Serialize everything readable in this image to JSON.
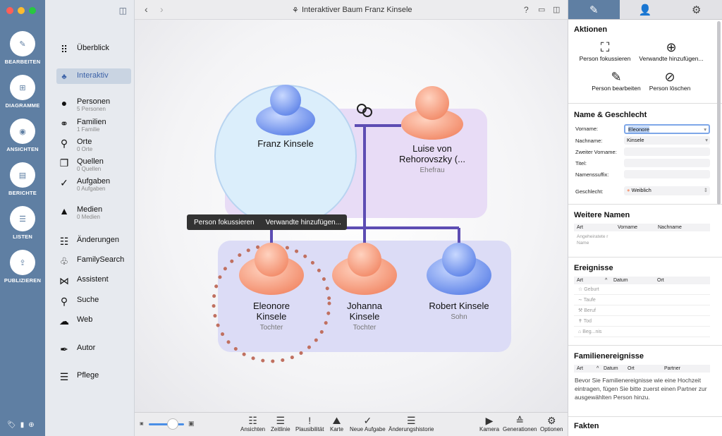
{
  "window_title": "Interaktiver Baum Franz Kinsele",
  "rail": [
    {
      "label": "BEARBEITEN",
      "icon": "pencil"
    },
    {
      "label": "DIAGRAMME",
      "icon": "diagram"
    },
    {
      "label": "ANSICHTEN",
      "icon": "eye"
    },
    {
      "label": "BERICHTE",
      "icon": "report"
    },
    {
      "label": "LISTEN",
      "icon": "list"
    },
    {
      "label": "PUBLIZIEREN",
      "icon": "upload"
    }
  ],
  "nav": [
    {
      "label": "Überblick",
      "sub": ""
    },
    {
      "label": "Interaktiv",
      "sub": ""
    },
    {
      "label": "Personen",
      "sub": "5 Personen"
    },
    {
      "label": "Familien",
      "sub": "1 Familie"
    },
    {
      "label": "Orte",
      "sub": "0 Orte"
    },
    {
      "label": "Quellen",
      "sub": "0 Quellen"
    },
    {
      "label": "Aufgaben",
      "sub": "0 Aufgaben"
    },
    {
      "label": "Medien",
      "sub": "0 Medien"
    },
    {
      "label": "Änderungen",
      "sub": ""
    },
    {
      "label": "FamilySearch",
      "sub": ""
    },
    {
      "label": "Assistent",
      "sub": ""
    },
    {
      "label": "Suche",
      "sub": ""
    },
    {
      "label": "Web",
      "sub": ""
    },
    {
      "label": "Autor",
      "sub": ""
    },
    {
      "label": "Pflege",
      "sub": ""
    }
  ],
  "tree": {
    "father": {
      "name": "Franz Kinsele",
      "role": ""
    },
    "mother": {
      "name": "Luise von Rehorovszky (...",
      "role": "Ehefrau"
    },
    "children": [
      {
        "name": "Eleonore Kinsele",
        "role": "Tochter"
      },
      {
        "name": "Johanna Kinsele",
        "role": "Tochter"
      },
      {
        "name": "Robert  Kinsele",
        "role": "Sohn"
      }
    ],
    "tooltip_focus": "Person fokussieren",
    "tooltip_add": "Verwandte hinzufügen..."
  },
  "bottombar": [
    "Ansichten",
    "Zeitlinie",
    "Plausibilität",
    "Karte",
    "Neue Aufgabe",
    "Änderungshistorie",
    "Kamera",
    "Generationen",
    "Optionen"
  ],
  "inspector": {
    "actions_title": "Aktionen",
    "actions": [
      "Person fokussieren",
      "Verwandte hinzufügen...",
      "Person bearbeiten",
      "Person löschen"
    ],
    "name_title": "Name & Geschlecht",
    "fields": [
      {
        "label": "Vorname:",
        "value": "Eleonore"
      },
      {
        "label": "Nachname:",
        "value": "Kinsele"
      },
      {
        "label": "Zweiter Vorname:",
        "value": ""
      },
      {
        "label": "Titel:",
        "value": ""
      },
      {
        "label": "Namenssuffix:",
        "value": ""
      },
      {
        "label": "Geschlecht:",
        "value": "Weiblich"
      }
    ],
    "other_names_title": "Weitere Namen",
    "other_names_cols": [
      "Art",
      "Vorname",
      "Nachname"
    ],
    "other_names_row": "Angeheiratete r Name",
    "events_title": "Ereignisse",
    "events_cols": [
      "Art",
      "Datum",
      "Ort"
    ],
    "events": [
      "Geburt",
      "Taufe",
      "Beruf",
      "Tod",
      "Beg...nis"
    ],
    "family_events_title": "Familienereignisse",
    "family_events_cols": [
      "Art",
      "Datum",
      "Ort",
      "Partner"
    ],
    "family_events_note": "Bevor Sie Familienereignisse wie eine Hochzeit eintragen, fügen Sie bitte zuerst einen Partner zur ausgewählten Person hinzu.",
    "facts_title": "Fakten"
  },
  "colors": {
    "rail": "#5f7fa3",
    "female": "#f8a88a",
    "male": "#7fa0ee",
    "link": "#6655bb"
  }
}
